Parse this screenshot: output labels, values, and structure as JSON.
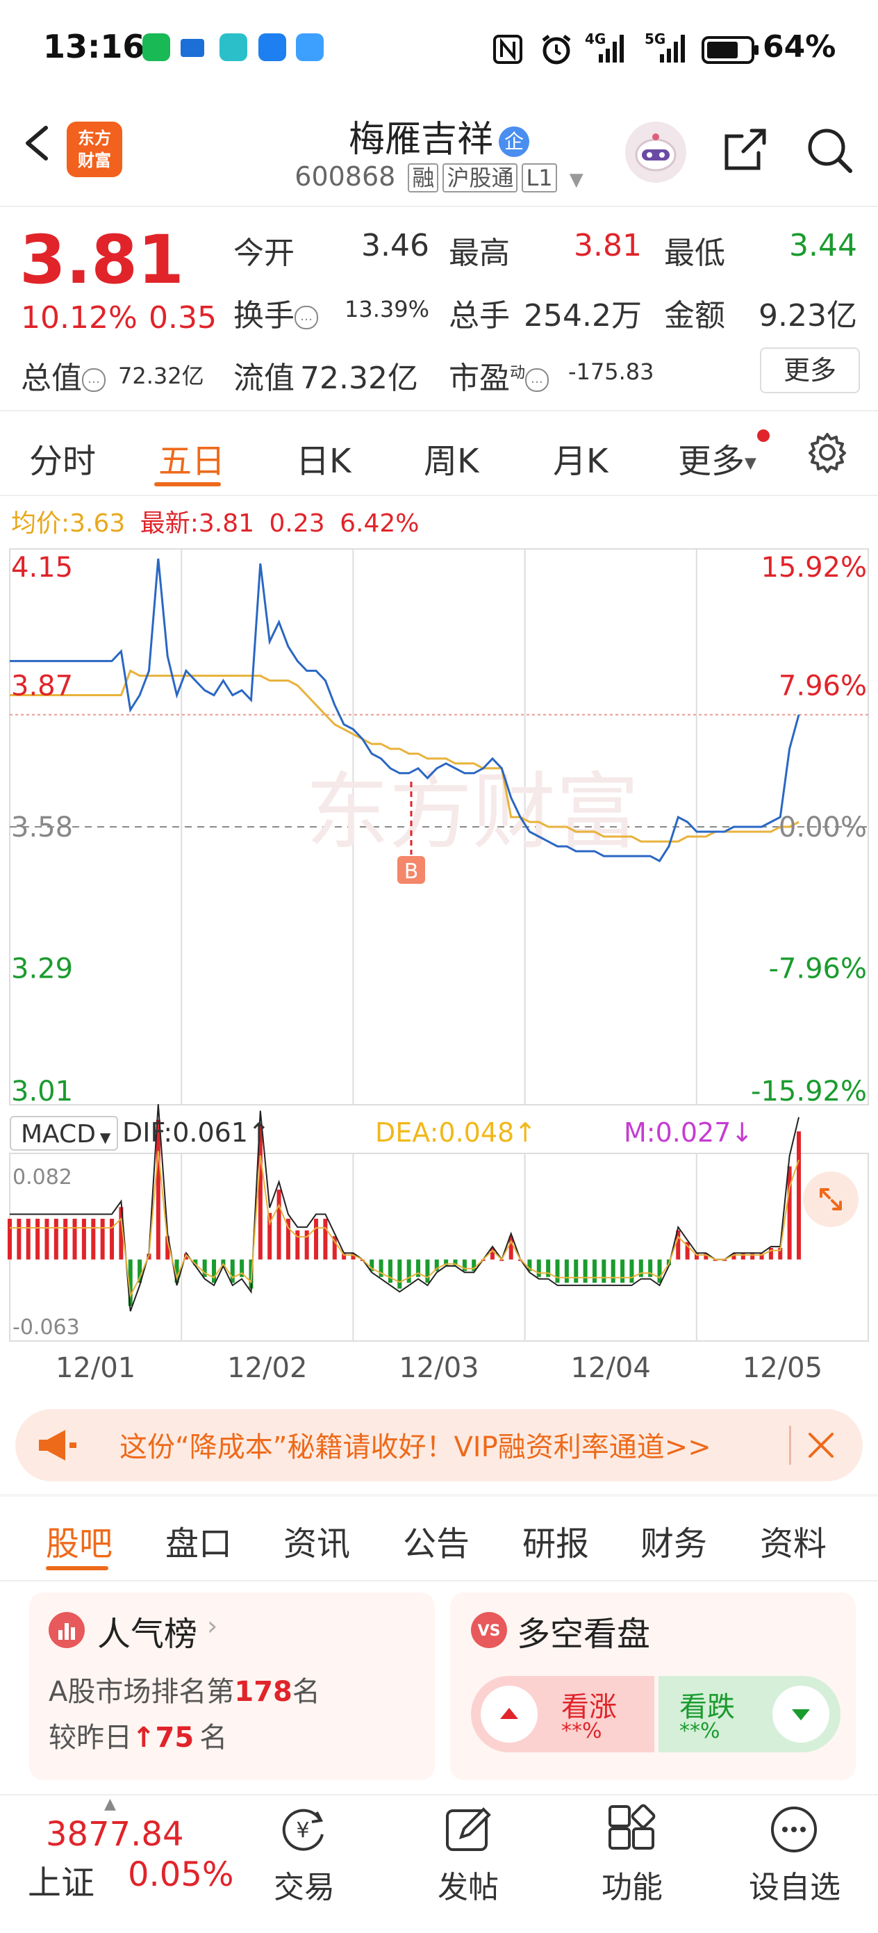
{
  "status_bar": {
    "time": "13:16",
    "battery": "64%",
    "signal_a": "4G",
    "signal_b": "5G"
  },
  "header": {
    "logo_line1": "东方",
    "logo_line2": "财富",
    "stock_name": "梅雁吉祥",
    "badge": "企",
    "stock_code": "600868",
    "tags": [
      "融",
      "沪股通",
      "L1"
    ]
  },
  "quote": {
    "price": "3.81",
    "change_pct": "10.12%",
    "change": "0.35",
    "open_label": "今开",
    "open": "3.46",
    "high_label": "最高",
    "high": "3.81",
    "low_label": "最低",
    "low": "3.44",
    "turnover_label": "换手",
    "turnover": "13.39%",
    "volume_label": "总手",
    "volume": "254.2万",
    "amount_label": "金额",
    "amount": "9.23亿",
    "mktcap_label": "总值",
    "mktcap": "72.32亿",
    "float_label": "流值",
    "float_cap": "72.32亿",
    "pe_label": "市盈",
    "pe_sup": "动",
    "pe": "-175.83",
    "more": "更多"
  },
  "tabs": [
    "分时",
    "五日",
    "日K",
    "周K",
    "月K",
    "更多"
  ],
  "active_tab": "五日",
  "avg_line": {
    "avg_label": "均价:",
    "avg": "3.63",
    "latest_label": "最新:",
    "latest": "3.81",
    "change": "0.23",
    "pct": "6.42%"
  },
  "chart_data": {
    "type": "line",
    "y_left_ticks": [
      "4.15",
      "3.87",
      "3.58",
      "3.29",
      "3.01"
    ],
    "y_right_ticks": [
      "15.92%",
      "7.96%",
      "0.00%",
      "-7.96%",
      "-15.92%"
    ],
    "x_labels": [
      "12/01",
      "12/02",
      "12/03",
      "12/04",
      "12/05"
    ],
    "ylim": [
      3.01,
      4.15
    ],
    "marker": "B",
    "series": [
      {
        "name": "price",
        "values": [
          3.92,
          3.92,
          3.92,
          3.92,
          3.92,
          3.92,
          3.92,
          3.92,
          3.92,
          3.92,
          3.92,
          3.92,
          3.94,
          3.82,
          3.85,
          3.9,
          4.13,
          3.93,
          3.85,
          3.9,
          3.88,
          3.86,
          3.85,
          3.88,
          3.85,
          3.86,
          3.84,
          4.12,
          3.96,
          4.0,
          3.95,
          3.92,
          3.9,
          3.9,
          3.88,
          3.83,
          3.79,
          3.78,
          3.76,
          3.73,
          3.72,
          3.7,
          3.69,
          3.69,
          3.7,
          3.68,
          3.7,
          3.71,
          3.7,
          3.69,
          3.69,
          3.7,
          3.72,
          3.7,
          3.64,
          3.6,
          3.57,
          3.56,
          3.55,
          3.54,
          3.54,
          3.53,
          3.53,
          3.53,
          3.52,
          3.52,
          3.52,
          3.52,
          3.52,
          3.52,
          3.51,
          3.54,
          3.6,
          3.59,
          3.57,
          3.57,
          3.57,
          3.57,
          3.58,
          3.58,
          3.58,
          3.58,
          3.59,
          3.6,
          3.74,
          3.81
        ]
      },
      {
        "name": "avg",
        "values": [
          3.85,
          3.85,
          3.85,
          3.85,
          3.85,
          3.85,
          3.85,
          3.85,
          3.85,
          3.85,
          3.85,
          3.85,
          3.85,
          3.9,
          3.89,
          3.89,
          3.89,
          3.89,
          3.89,
          3.89,
          3.89,
          3.89,
          3.89,
          3.89,
          3.89,
          3.89,
          3.89,
          3.89,
          3.88,
          3.88,
          3.88,
          3.87,
          3.85,
          3.83,
          3.81,
          3.79,
          3.78,
          3.77,
          3.76,
          3.75,
          3.75,
          3.74,
          3.74,
          3.73,
          3.73,
          3.72,
          3.72,
          3.72,
          3.71,
          3.71,
          3.71,
          3.7,
          3.7,
          3.7,
          3.6,
          3.6,
          3.59,
          3.59,
          3.58,
          3.58,
          3.58,
          3.57,
          3.57,
          3.57,
          3.56,
          3.56,
          3.56,
          3.56,
          3.55,
          3.55,
          3.55,
          3.55,
          3.55,
          3.56,
          3.56,
          3.56,
          3.57,
          3.57,
          3.57,
          3.57,
          3.57,
          3.57,
          3.57,
          3.58,
          3.58,
          3.59
        ]
      }
    ],
    "macd": {
      "label": "MACD",
      "dif_label": "DIF:",
      "dif": "0.061",
      "dea_label": "DEA:",
      "dea": "0.048",
      "m_label": "M:",
      "m": "0.027",
      "top": "0.082",
      "bottom": "-0.063"
    }
  },
  "vip_banner": {
    "text": "这份“降成本”秘籍请收好！VIP融资利率通道>>"
  },
  "section_tabs": [
    "股吧",
    "盘口",
    "资讯",
    "公告",
    "研报",
    "财务",
    "资料"
  ],
  "active_section_tab": "股吧",
  "popularity_card": {
    "title": "人气榜",
    "line1_prefix": "A股市场排名第",
    "rank": "178",
    "line1_suffix": "名",
    "line2_prefix": "较昨日",
    "change": "75",
    "line2_suffix": "名"
  },
  "sentiment_card": {
    "title": "多空看盘",
    "bull_label": "看涨",
    "bull_value": "**%",
    "bear_label": "看跌",
    "bear_value": "**%"
  },
  "bottom_nav": {
    "index_value": "3877.84",
    "index_name": "上证",
    "index_pct": "0.05%",
    "trade": "交易",
    "post": "发帖",
    "functions": "功能",
    "watchlist": "设自选"
  },
  "colors": {
    "up": "#e0242a",
    "down": "#1a9b2e",
    "accent": "#ee6a1b",
    "price_line": "#2a67c3",
    "avg_line": "#e8b23c"
  }
}
